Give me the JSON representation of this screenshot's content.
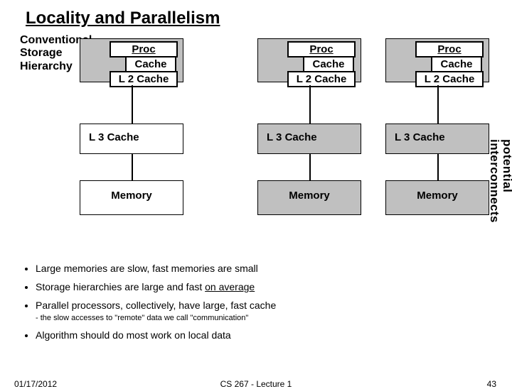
{
  "title": "Locality and Parallelism",
  "label": {
    "l1": "Conventional",
    "l2": "Storage",
    "l3": "Hierarchy"
  },
  "box": {
    "proc": "Proc",
    "cache": "Cache",
    "l2": "L 2 Cache",
    "l3": "L 3 Cache",
    "mem": "Memory"
  },
  "side": {
    "a": "potential",
    "b": "interconnects"
  },
  "bullets": {
    "b1": "Large memories are slow, fast memories are small",
    "b2a": "Storage hierarchies are large and fast ",
    "b2b": "on average",
    "b3": "Parallel processors, collectively, have large, fast cache",
    "b3s": "the slow accesses to \"remote\" data we call \"communication\"",
    "b4": "Algorithm should do most work on local data"
  },
  "footer": {
    "date": "01/17/2012",
    "course": "CS 267 - Lecture 1",
    "page": "43"
  }
}
